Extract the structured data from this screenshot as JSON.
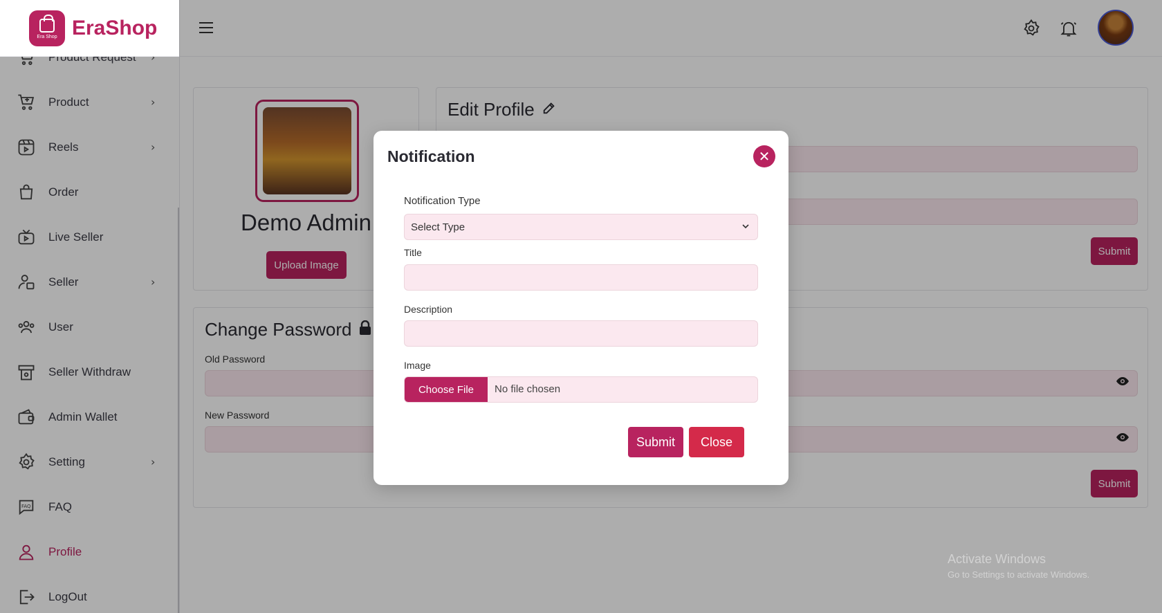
{
  "brand": {
    "name": "EraShop",
    "logo_caption": "Era Shop"
  },
  "sidebar": {
    "items": [
      {
        "label": "Product Request",
        "icon": "cart-icon",
        "has_arrow": true
      },
      {
        "label": "Product",
        "icon": "cart-plus-icon",
        "has_arrow": true
      },
      {
        "label": "Reels",
        "icon": "reels-icon",
        "has_arrow": true
      },
      {
        "label": "Order",
        "icon": "bag-icon",
        "has_arrow": false
      },
      {
        "label": "Live Seller",
        "icon": "tv-icon",
        "has_arrow": false
      },
      {
        "label": "Seller",
        "icon": "seller-icon",
        "has_arrow": true
      },
      {
        "label": "User",
        "icon": "users-icon",
        "has_arrow": false
      },
      {
        "label": "Seller Withdraw",
        "icon": "withdraw-icon",
        "has_arrow": false
      },
      {
        "label": "Admin Wallet",
        "icon": "wallet-icon",
        "has_arrow": false
      },
      {
        "label": "Setting",
        "icon": "gear-icon",
        "has_arrow": true
      },
      {
        "label": "FAQ",
        "icon": "faq-icon",
        "has_arrow": false
      },
      {
        "label": "Profile",
        "icon": "user-icon",
        "has_arrow": false,
        "active": true
      },
      {
        "label": "LogOut",
        "icon": "logout-icon",
        "has_arrow": false
      }
    ]
  },
  "profile": {
    "name": "Demo Admin",
    "upload_label": "Upload Image"
  },
  "edit_profile": {
    "title": "Edit Profile",
    "submit_label": "Submit"
  },
  "change_password": {
    "title": "Change Password",
    "old_label": "Old Password",
    "new_label": "New Password",
    "submit_label": "Submit"
  },
  "watermark": {
    "line1": "Activate Windows",
    "line2": "Go to Settings to activate Windows."
  },
  "modal": {
    "title": "Notification",
    "type_label": "Notification Type",
    "type_value": "Select Type",
    "title_label": "Title",
    "title_value": "",
    "description_label": "Description",
    "description_value": "",
    "image_label": "Image",
    "choose_file_label": "Choose File",
    "no_file_text": "No file chosen",
    "submit_label": "Submit",
    "close_label": "Close"
  },
  "colors": {
    "accent": "#b8235f",
    "close": "#d42a4a",
    "field_bg": "#fbe8ef"
  }
}
